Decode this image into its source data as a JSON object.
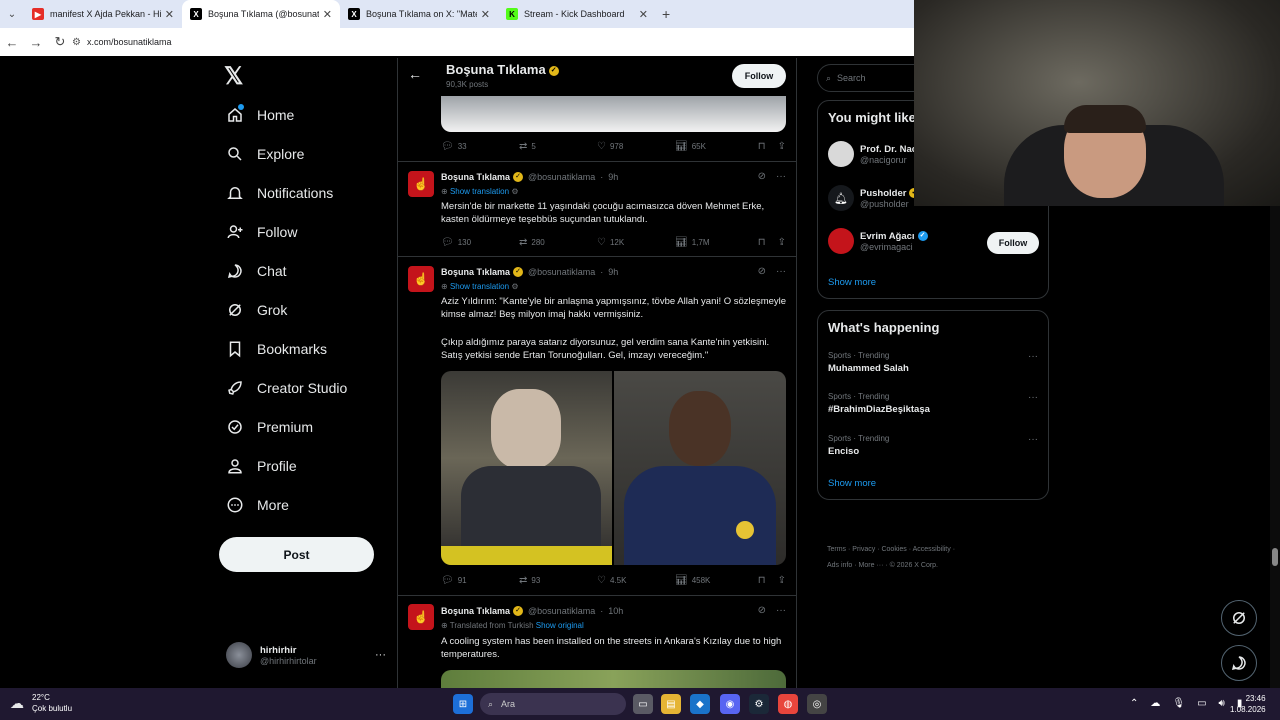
{
  "browser": {
    "tabs": [
      {
        "title": "manifest X Ajda Pekkan - Hileli"
      },
      {
        "title": "Boşuna Tıklama (@bosunatiklar"
      },
      {
        "title": "Boşuna Tıklama on X: \"Matema"
      },
      {
        "title": "Stream - Kick Dashboard"
      }
    ],
    "url": "x.com/bosunatiklama"
  },
  "sidebar": {
    "items": [
      {
        "label": "Home"
      },
      {
        "label": "Explore"
      },
      {
        "label": "Notifications"
      },
      {
        "label": "Follow"
      },
      {
        "label": "Chat"
      },
      {
        "label": "Grok"
      },
      {
        "label": "Bookmarks"
      },
      {
        "label": "Creator Studio"
      },
      {
        "label": "Premium"
      },
      {
        "label": "Profile"
      },
      {
        "label": "More"
      }
    ],
    "post_label": "Post",
    "account": {
      "name": "hirhirhir",
      "handle": "@hirhirhirtolar"
    }
  },
  "profile_header": {
    "name": "Boşuna Tıklama",
    "posts": "90,3K posts",
    "follow_label": "Follow"
  },
  "tweets": [
    {
      "stats": {
        "replies": "33",
        "reposts": "5",
        "likes": "978",
        "views": "65K"
      }
    },
    {
      "name": "Boşuna Tıklama",
      "handle": "@bosunatiklama",
      "time": "9h",
      "translation": "Show translation",
      "text": "Mersin'de bir markette 11 yaşındaki çocuğu acımasızca döven Mehmet Erke, kasten öldürmeye teşebbüs suçundan tutuklandı.",
      "stats": {
        "replies": "130",
        "reposts": "280",
        "likes": "12K",
        "views": "1,7M"
      }
    },
    {
      "name": "Boşuna Tıklama",
      "handle": "@bosunatiklama",
      "time": "9h",
      "translation": "Show translation",
      "text1": "Aziz Yıldırım: \"Kante'yle bir anlaşma yapmışsınız, tövbe Allah yani! O sözleşmeyle kimse almaz! Beş milyon imaj hakkı vermişsiniz.",
      "text2": "Çıkıp aldığımız paraya satarız diyorsunuz, gel verdim sana Kante'nin yetkisini. Satış yetkisi sende Ertan Torunoğulları. Gel, imzayı vereceğim.\"",
      "stats": {
        "replies": "91",
        "reposts": "93",
        "likes": "4.5K",
        "views": "458K"
      }
    },
    {
      "name": "Boşuna Tıklama",
      "handle": "@bosunatiklama",
      "time": "10h",
      "translated_from": "Translated from Turkish",
      "show_original": "Show original",
      "text": "A cooling system has been installed on the streets in Ankara's Kızılay due to high temperatures."
    }
  ],
  "right": {
    "search_placeholder": "Search",
    "who_title": "You might like",
    "who": [
      {
        "name": "Prof. Dr. Nac",
        "handle": "@nacigorur"
      },
      {
        "name": "Pusholder",
        "handle": "@pusholder"
      },
      {
        "name": "Evrim Ağacı",
        "handle": "@evrimagaci",
        "follow": "Follow"
      }
    ],
    "show_more": "Show more",
    "happening_title": "What's happening",
    "trends": [
      {
        "category": "Sports · Trending",
        "topic": "Muhammed Salah"
      },
      {
        "category": "Sports · Trending",
        "topic": "#BrahimDiazBeşiktaşa"
      },
      {
        "category": "Sports · Trending",
        "topic": "Enciso"
      }
    ],
    "footer_links": [
      "Terms",
      "Privacy",
      "Cookies",
      "Accessibility",
      "Ads info",
      "More ···",
      "© 2026 X Corp."
    ]
  },
  "taskbar": {
    "weather_temp": "22°C",
    "weather_desc": "Çok bulutlu",
    "search_placeholder": "Ara",
    "time": "23:46",
    "date": "1.08.2026"
  },
  "colors": {
    "accent": "#1d9bf0",
    "verified_gold": "#e2b719",
    "avatar_red": "#c4141b"
  }
}
